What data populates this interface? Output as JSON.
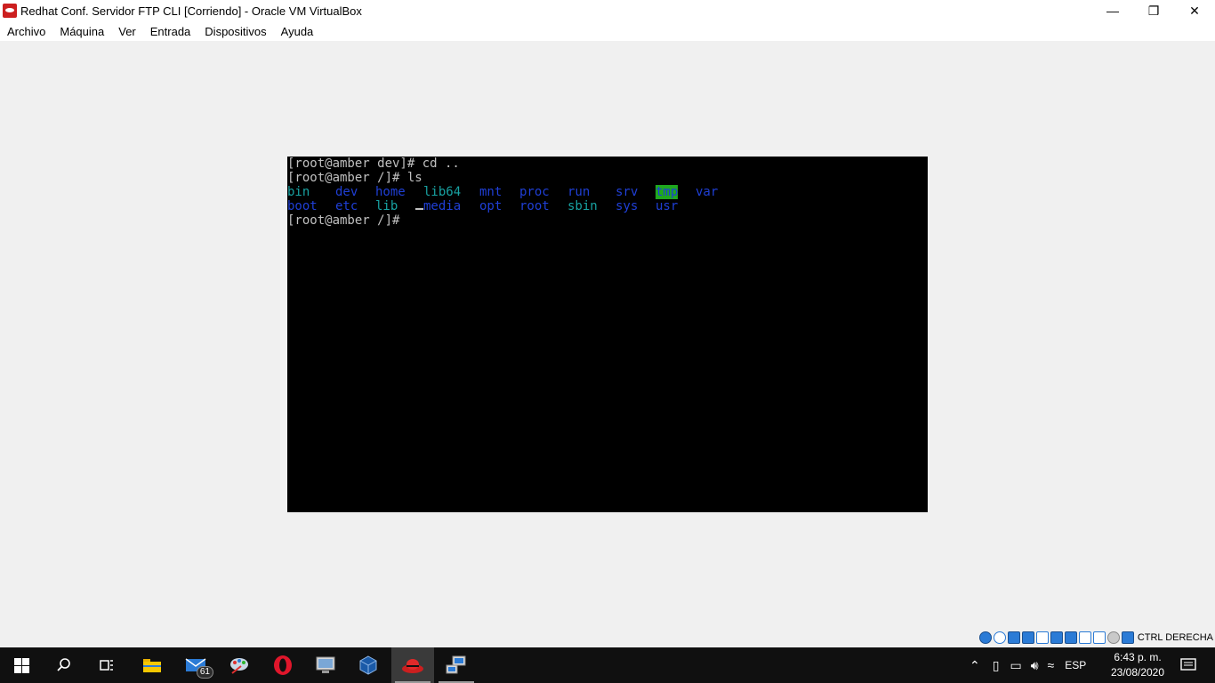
{
  "window": {
    "title": "Redhat Conf. Servidor FTP CLI [Corriendo] - Oracle VM VirtualBox",
    "minimize": "—",
    "restore": "❐",
    "close": "✕"
  },
  "menu": {
    "items": [
      "Archivo",
      "Máquina",
      "Ver",
      "Entrada",
      "Dispositivos",
      "Ayuda"
    ]
  },
  "console": {
    "lines": [
      "[root@amber dev]# cd ..",
      "[root@amber /]# ls",
      "[root@amber /]# "
    ],
    "ls_row1": [
      {
        "name": "bin",
        "kind": "link"
      },
      {
        "name": "dev",
        "kind": "dir"
      },
      {
        "name": "home",
        "kind": "dir"
      },
      {
        "name": "lib64",
        "kind": "link"
      },
      {
        "name": "mnt",
        "kind": "dir"
      },
      {
        "name": "proc",
        "kind": "dir"
      },
      {
        "name": "run",
        "kind": "dir"
      },
      {
        "name": "srv",
        "kind": "dir"
      },
      {
        "name": "tmp",
        "kind": "sticky"
      },
      {
        "name": "var",
        "kind": "dir"
      }
    ],
    "ls_row2": [
      {
        "name": "boot",
        "kind": "dir"
      },
      {
        "name": "etc",
        "kind": "dir"
      },
      {
        "name": "lib",
        "kind": "link"
      },
      {
        "name": "media",
        "kind": "dir"
      },
      {
        "name": "opt",
        "kind": "dir"
      },
      {
        "name": "root",
        "kind": "dir"
      },
      {
        "name": "sbin",
        "kind": "link"
      },
      {
        "name": "sys",
        "kind": "dir"
      },
      {
        "name": "usr",
        "kind": "dir"
      }
    ],
    "colors": {
      "dir": "#1f3fd6",
      "link": "#18a3a3",
      "sticky_bg": "#1fa81f",
      "text": "#c0c0c0",
      "background": "#000000"
    }
  },
  "statusbar": {
    "icons": [
      "hard-disk-icon",
      "optical-drive-icon",
      "audio-icon",
      "network-icon",
      "usb-icon",
      "shared-folders-icon",
      "display-icon",
      "video-capture-icon",
      "cpu-icon",
      "mouse-integration-icon",
      "keyboard-icon"
    ],
    "host_key": "CTRL DERECHA"
  },
  "taskbar": {
    "apps": [
      {
        "icon": "search-icon",
        "glyph": "⚲"
      },
      {
        "icon": "task-view-icon",
        "glyph": "❑"
      },
      {
        "icon": "file-explorer-icon",
        "glyph": ""
      },
      {
        "icon": "mail-icon",
        "glyph": "✉",
        "badge": "61"
      },
      {
        "icon": "paint-app-icon",
        "glyph": ""
      },
      {
        "icon": "opera-browser-icon",
        "glyph": "O"
      },
      {
        "icon": "system-tool-icon",
        "glyph": ""
      },
      {
        "icon": "virtualbox-icon",
        "glyph": ""
      },
      {
        "icon": "redhat-vm-icon",
        "glyph": ""
      },
      {
        "icon": "network-vm-icon",
        "glyph": ""
      }
    ],
    "tray": {
      "language": "ESP",
      "time": "6:43 p. m.",
      "date": "23/08/2020"
    }
  }
}
